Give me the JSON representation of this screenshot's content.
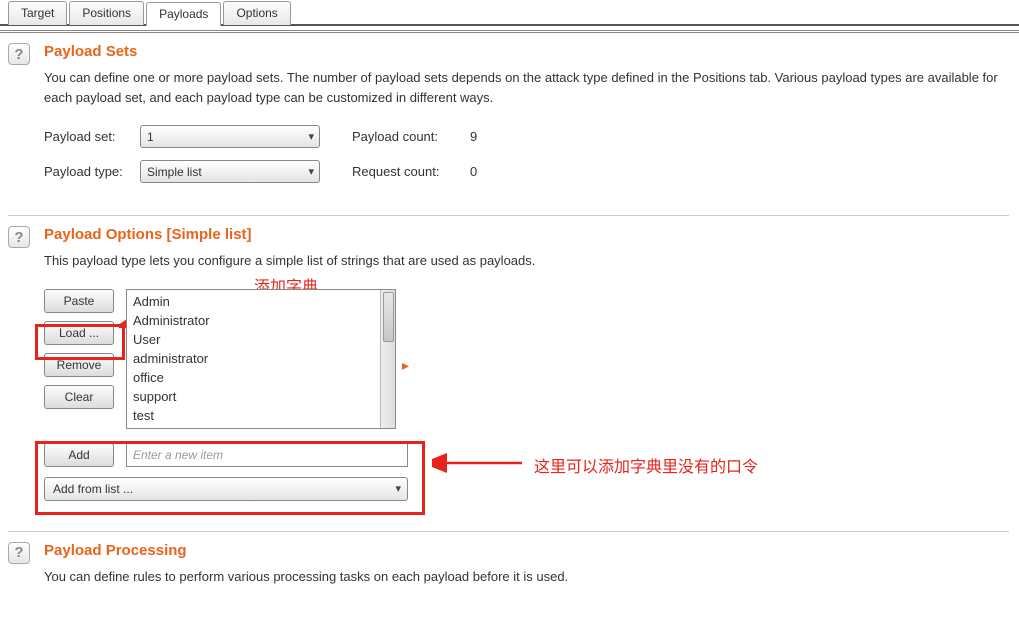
{
  "tabs": {
    "t0": "Target",
    "t1": "Positions",
    "t2": "Payloads",
    "t3": "Options"
  },
  "help": "?",
  "sets": {
    "title": "Payload Sets",
    "desc": "You can define one or more payload sets. The number of payload sets depends on the attack type defined in the Positions tab. Various payload types are available for each payload set, and each payload type can be customized in different ways.",
    "set_label": "Payload set:",
    "set_value": "1",
    "type_label": "Payload type:",
    "type_value": "Simple list",
    "pcount_label": "Payload count:",
    "pcount_value": "9",
    "rcount_label": "Request count:",
    "rcount_value": "0"
  },
  "options": {
    "title": "Payload Options [Simple list]",
    "desc": "This payload type lets you configure a simple list of strings that are used as payloads.",
    "btn_paste": "Paste",
    "btn_load": "Load ...",
    "btn_remove": "Remove",
    "btn_clear": "Clear",
    "btn_add": "Add",
    "add_placeholder": "Enter a new item",
    "add_from_list": "Add from list ...",
    "items": [
      "Admin",
      "Administrator",
      "User",
      "administrator",
      "office",
      "support",
      "test"
    ]
  },
  "processing": {
    "title": "Payload Processing",
    "desc": "You can define rules to perform various processing tasks on each payload before it is used."
  },
  "annotations": {
    "dict_label": "添加字典",
    "add_hint": "这里可以添加字典里没有的口令"
  }
}
